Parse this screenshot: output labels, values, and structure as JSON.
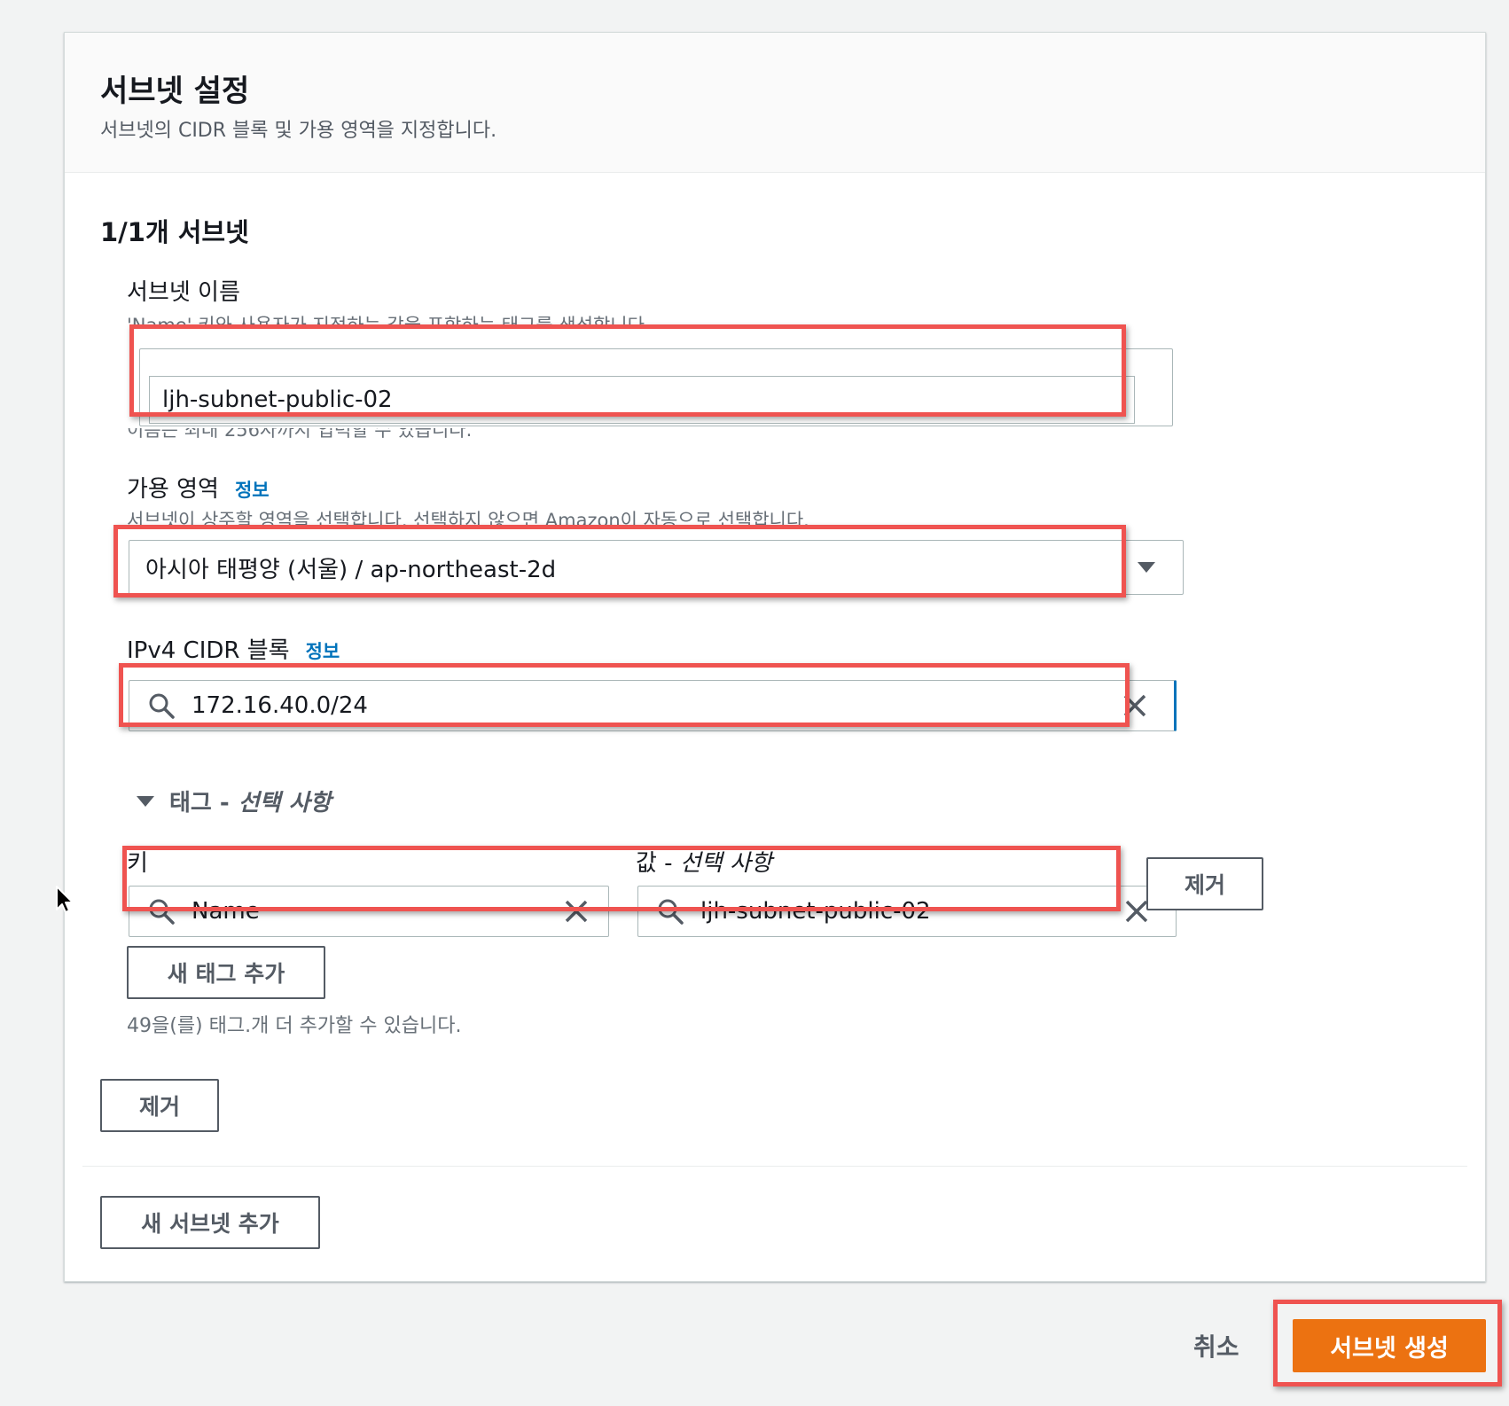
{
  "section": {
    "title": "서브넷 설정",
    "description": "서브넷의 CIDR 블록 및 가용 영역을 지정합니다."
  },
  "subnet": {
    "count": "1/1개 서브넷",
    "name_label": "서브넷 이름",
    "name_desc": "'Name' 키와 사용자가 지정하는 값을 포함하는 태그를 생성합니다.",
    "name_value": "ljh-subnet-public-02",
    "name_constraint": "이름은 최대 256자까지 입력할 수 있습니다.",
    "az_label": "가용 영역",
    "az_info": "정보",
    "az_desc": "서브넷이 상주할 영역을 선택합니다. 선택하지 않으면 Amazon이 자동으로 선택합니다.",
    "az_value": "아시아 태평양 (서울) / ap-northeast-2d",
    "cidr_label": "IPv4 CIDR 블록",
    "cidr_info": "정보",
    "cidr_value": "172.16.40.0/24"
  },
  "tags": {
    "toggle_label": "태그 -",
    "toggle_optional": "선택 사항",
    "key_label": "키",
    "value_label": "값 -",
    "value_optional": "선택 사항",
    "key_value": "Name",
    "value_value": "ljh-subnet-public-02",
    "remove_tag": "제거",
    "add_tag": "새 태그 추가",
    "remaining": "49을(를) 태그.개 더 추가할 수 있습니다."
  },
  "actions": {
    "remove_subnet": "제거",
    "add_subnet": "새 서브넷 추가",
    "cancel": "취소",
    "create": "서브넷 생성"
  },
  "colors": {
    "primary": "#ec7211",
    "link": "#0073bb",
    "highlight": "#ef5350"
  }
}
